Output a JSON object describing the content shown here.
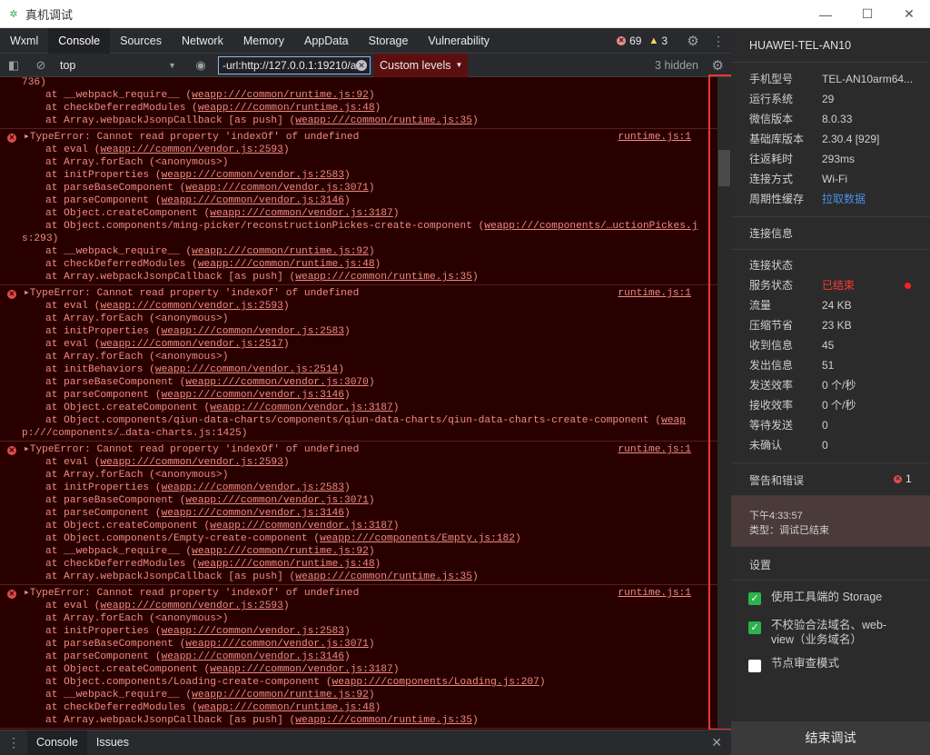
{
  "window": {
    "title": "真机调试",
    "minimize": "—",
    "maximize": "☐",
    "close": "✕"
  },
  "tabs": [
    "Wxml",
    "Console",
    "Sources",
    "Network",
    "Memory",
    "AppData",
    "Storage",
    "Vulnerability"
  ],
  "counts": {
    "errors": "69",
    "warnings": "3"
  },
  "toolbar": {
    "context": "top",
    "filter_value": "-url:http://127.0.0.1:19210/a",
    "levels": "Custom levels",
    "hidden": "3 hidden"
  },
  "console": {
    "head": [
      "736)",
      "    at __webpack_require__ (",
      "weapp:///common/runtime.js:92",
      ")",
      "    at checkDeferredModules (",
      "weapp:///common/runtime.js:48",
      ")",
      "    at Array.webpackJsonpCallback [as push] (",
      "weapp:///common/runtime.js:35",
      ")"
    ],
    "messages": [
      {
        "text": "TypeError: Cannot read property 'indexOf' of undefined",
        "source": "runtime.js:1",
        "frames": [
          [
            "at eval (",
            "weapp:///common/vendor.js:2593",
            ")"
          ],
          [
            "at Array.forEach (<anonymous>)",
            "",
            ""
          ],
          [
            "at initProperties (",
            "weapp:///common/vendor.js:2583",
            ")"
          ],
          [
            "at parseBaseComponent (",
            "weapp:///common/vendor.js:3071",
            ")"
          ],
          [
            "at parseComponent (",
            "weapp:///common/vendor.js:3146",
            ")"
          ],
          [
            "at Object.createComponent (",
            "weapp:///common/vendor.js:3187",
            ")"
          ],
          [
            "at Object.components/ming-picker/reconstructionPickes-create-component (",
            "weapp:///components/…uctionPickes.j",
            ""
          ],
          [
            "s:293",
            "",
            ")"
          ],
          [
            "at __webpack_require__ (",
            "weapp:///common/runtime.js:92",
            ")"
          ],
          [
            "at checkDeferredModules (",
            "weapp:///common/runtime.js:48",
            ")"
          ],
          [
            "at Array.webpackJsonpCallback [as push] (",
            "weapp:///common/runtime.js:35",
            ")"
          ]
        ]
      },
      {
        "text": "TypeError: Cannot read property 'indexOf' of undefined",
        "source": "runtime.js:1",
        "frames": [
          [
            "at eval (",
            "weapp:///common/vendor.js:2593",
            ")"
          ],
          [
            "at Array.forEach (<anonymous>)",
            "",
            ""
          ],
          [
            "at initProperties (",
            "weapp:///common/vendor.js:2583",
            ")"
          ],
          [
            "at eval (",
            "weapp:///common/vendor.js:2517",
            ")"
          ],
          [
            "at Array.forEach (<anonymous>)",
            "",
            ""
          ],
          [
            "at initBehaviors (",
            "weapp:///common/vendor.js:2514",
            ")"
          ],
          [
            "at parseBaseComponent (",
            "weapp:///common/vendor.js:3070",
            ")"
          ],
          [
            "at parseComponent (",
            "weapp:///common/vendor.js:3146",
            ")"
          ],
          [
            "at Object.createComponent (",
            "weapp:///common/vendor.js:3187",
            ")"
          ],
          [
            "at Object.components/qiun-data-charts/components/qiun-data-charts/qiun-data-charts-create-component (",
            "weap",
            ""
          ],
          [
            "p:///components/…data-charts.js:1425",
            "",
            ")"
          ]
        ]
      },
      {
        "text": "TypeError: Cannot read property 'indexOf' of undefined",
        "source": "runtime.js:1",
        "frames": [
          [
            "at eval (",
            "weapp:///common/vendor.js:2593",
            ")"
          ],
          [
            "at Array.forEach (<anonymous>)",
            "",
            ""
          ],
          [
            "at initProperties (",
            "weapp:///common/vendor.js:2583",
            ")"
          ],
          [
            "at parseBaseComponent (",
            "weapp:///common/vendor.js:3071",
            ")"
          ],
          [
            "at parseComponent (",
            "weapp:///common/vendor.js:3146",
            ")"
          ],
          [
            "at Object.createComponent (",
            "weapp:///common/vendor.js:3187",
            ")"
          ],
          [
            "at Object.components/Empty-create-component (",
            "weapp:///components/Empty.js:182",
            ")"
          ],
          [
            "at __webpack_require__ (",
            "weapp:///common/runtime.js:92",
            ")"
          ],
          [
            "at checkDeferredModules (",
            "weapp:///common/runtime.js:48",
            ")"
          ],
          [
            "at Array.webpackJsonpCallback [as push] (",
            "weapp:///common/runtime.js:35",
            ")"
          ]
        ]
      },
      {
        "text": "TypeError: Cannot read property 'indexOf' of undefined",
        "source": "runtime.js:1",
        "frames": [
          [
            "at eval (",
            "weapp:///common/vendor.js:2593",
            ")"
          ],
          [
            "at Array.forEach (<anonymous>)",
            "",
            ""
          ],
          [
            "at initProperties (",
            "weapp:///common/vendor.js:2583",
            ")"
          ],
          [
            "at parseBaseComponent (",
            "weapp:///common/vendor.js:3071",
            ")"
          ],
          [
            "at parseComponent (",
            "weapp:///common/vendor.js:3146",
            ")"
          ],
          [
            "at Object.createComponent (",
            "weapp:///common/vendor.js:3187",
            ")"
          ],
          [
            "at Object.components/Loading-create-component (",
            "weapp:///components/Loading.js:207",
            ")"
          ],
          [
            "at __webpack_require__ (",
            "weapp:///common/runtime.js:92",
            ")"
          ],
          [
            "at checkDeferredModules (",
            "weapp:///common/runtime.js:48",
            ")"
          ],
          [
            "at Array.webpackJsonpCallback [as push] (",
            "weapp:///common/runtime.js:35",
            ")"
          ]
        ]
      }
    ]
  },
  "bottom_tabs": [
    "Console",
    "Issues"
  ],
  "side": {
    "device": "HUAWEI-TEL-AN10",
    "info": [
      {
        "k": "手机型号",
        "v": "TEL-AN10arm64..."
      },
      {
        "k": "运行系统",
        "v": "29"
      },
      {
        "k": "微信版本",
        "v": "8.0.33"
      },
      {
        "k": "基础库版本",
        "v": "2.30.4 [929]"
      },
      {
        "k": "往返耗时",
        "v": "293ms"
      },
      {
        "k": "连接方式",
        "v": "Wi-Fi"
      },
      {
        "k": "周期性缓存",
        "v": "拉取数据"
      }
    ],
    "conn_title": "连接信息",
    "conn": [
      {
        "k": "连接状态",
        "v": ""
      },
      {
        "k": "服务状态",
        "v": "已结束"
      },
      {
        "k": "流量",
        "v": "24 KB"
      },
      {
        "k": "压缩节省",
        "v": "23 KB"
      },
      {
        "k": "收到信息",
        "v": "45"
      },
      {
        "k": "发出信息",
        "v": "51"
      },
      {
        "k": "发送效率",
        "v": "0 个/秒"
      },
      {
        "k": "接收效率",
        "v": "0 个/秒"
      },
      {
        "k": "等待发送",
        "v": "0"
      },
      {
        "k": "未确认",
        "v": "0"
      }
    ],
    "warn_title": "警告和错误",
    "warn_count": "1",
    "alert": {
      "time": "下午4:33:57",
      "type": "类型：调试已结束"
    },
    "settings_title": "设置",
    "settings": [
      {
        "label": "使用工具端的 Storage",
        "checked": true
      },
      {
        "label": "不校验合法域名、web-view（业务域名）",
        "checked": true
      },
      {
        "label": "节点审查模式",
        "checked": false
      }
    ],
    "end_button": "结束调试"
  },
  "colors": {
    "accent": "#2bb24c",
    "error": "#f28b82",
    "console_bg": "#290000",
    "highlight": "#e53935"
  }
}
